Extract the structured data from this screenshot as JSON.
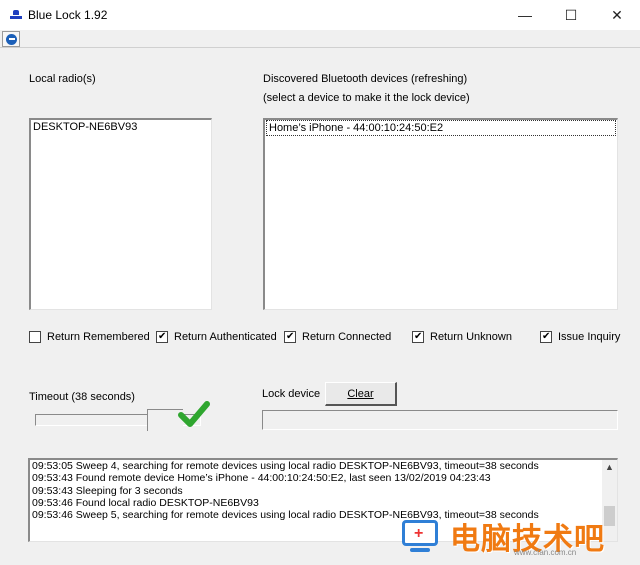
{
  "window": {
    "title": "Blue Lock 1.92",
    "controls": {
      "minimize": "—",
      "maximize": "☐",
      "close": "✕"
    }
  },
  "toolbar": {
    "icon": "ie-globe-icon"
  },
  "local_radios": {
    "label": "Local radio(s)",
    "items": [
      "DESKTOP-NE6BV93"
    ]
  },
  "discovered": {
    "label_line1": "Discovered Bluetooth devices (refreshing)",
    "label_line2": "(select a device to make it the lock device)",
    "items": [
      "Home’s iPhone - 44:00:10:24:50:E2"
    ]
  },
  "options": [
    {
      "label": "Return Remembered",
      "checked": false
    },
    {
      "label": "Return Authenticated",
      "checked": true
    },
    {
      "label": "Return Connected",
      "checked": true
    },
    {
      "label": "Return Unknown",
      "checked": true
    },
    {
      "label": "Issue Inquiry",
      "checked": true
    }
  ],
  "timeout": {
    "label": "Timeout (38 seconds)",
    "value_seconds": 38
  },
  "lock": {
    "label": "Lock device",
    "clear_button": "Clear",
    "value": ""
  },
  "log": {
    "lines": [
      "09:53:05 Sweep 4, searching for remote devices using local radio DESKTOP-NE6BV93, timeout=38 seconds",
      "09:53:43 Found remote device Home’s iPhone - 44:00:10:24:50:E2, last seen 13/02/2019 04:23:43",
      "09:53:43 Sleeping for 3 seconds",
      "09:53:46 Found local radio DESKTOP-NE6BV93",
      "09:53:46 Sweep 5, searching for remote devices using local radio DESKTOP-NE6BV93, timeout=38 seconds"
    ]
  },
  "watermark": {
    "text": "电脑技术吧",
    "url": "www.cfan.com.cn"
  },
  "colors": {
    "check_green": "#2fa62f",
    "watermark_orange": "#f07a12",
    "app_icon_blue": "#1f3fbf"
  }
}
